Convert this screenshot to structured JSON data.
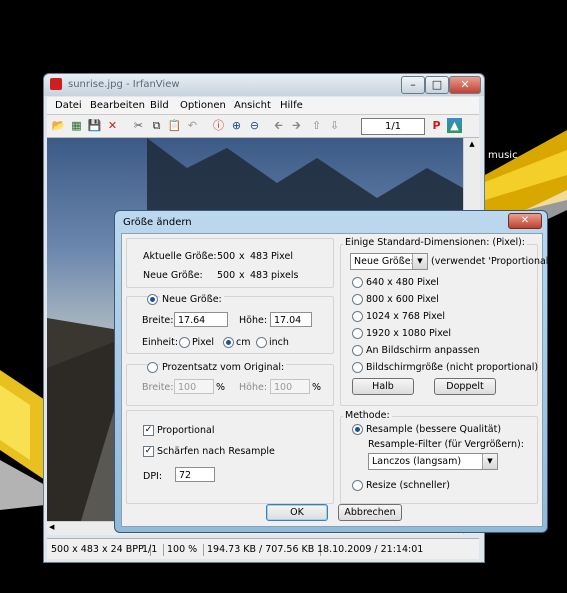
{
  "desktop": {
    "music_label": "music"
  },
  "window": {
    "title": "sunrise.jpg - IrfanView",
    "menu": [
      "Datei",
      "Bearbeiten",
      "Bild",
      "Optionen",
      "Ansicht",
      "Hilfe"
    ],
    "page_counter": "1/1",
    "status": [
      "500 x 483 x 24 BPP",
      "1/1",
      "100 %",
      "194.73 KB / 707.56 KB",
      "18.10.2009 / 21:14:01"
    ]
  },
  "dialog": {
    "title": "Größe ändern",
    "current_size": {
      "label": "Aktuelle Größe:",
      "w": "500",
      "x": "x",
      "h": "483",
      "unit": "Pixel"
    },
    "new_size_info": {
      "label": "Neue Größe:",
      "w": "500",
      "x": "x",
      "h": "483",
      "unit": "pixels"
    },
    "new_size": {
      "radio_label": "Neue Größe:",
      "width_label": "Breite:",
      "width_value": "17.64",
      "height_label": "Höhe:",
      "height_value": "17.04",
      "unit_label": "Einheit:",
      "units": [
        "Pixel",
        "cm",
        "inch"
      ],
      "selected_unit": "cm"
    },
    "percent": {
      "radio_label": "Prozentsatz vom Original:",
      "width_label": "Breite:",
      "width_value": "100",
      "width_suffix": "%",
      "height_label": "Höhe:",
      "height_value": "100",
      "height_suffix": "%"
    },
    "options": {
      "proportional": "Proportional",
      "sharpen": "Schärfen nach Resample",
      "dpi_label": "DPI:",
      "dpi_value": "72"
    },
    "std_dims": {
      "title": "Einige Standard-Dimensionen: (Pixel):",
      "select_value": "Neue Größe:",
      "note": "(verwendet 'Proportional')",
      "items": [
        "640 x 480 Pixel",
        "800 x 600 Pixel",
        "1024 x 768 Pixel",
        "1920 x 1080 Pixel",
        "An Bildschirm anpassen",
        "Bildschirmgröße (nicht proportional)"
      ],
      "half_button": "Halb",
      "double_button": "Doppelt"
    },
    "method": {
      "title": "Methode:",
      "resample": "Resample (bessere Qualität)",
      "filter_label": "Resample-Filter (für Vergrößern):",
      "filter_value": "Lanczos (langsam)",
      "resize": "Resize (schneller)"
    },
    "ok_button": "OK",
    "cancel_button": "Abbrechen"
  }
}
